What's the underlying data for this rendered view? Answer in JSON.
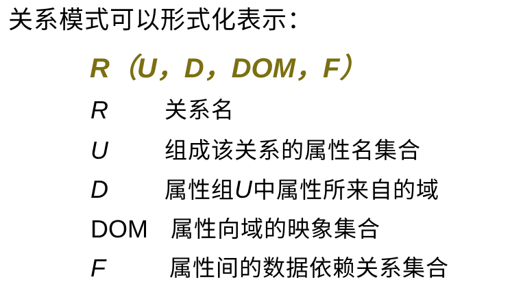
{
  "heading": "关系模式可以形式化表示：",
  "formula": "R（U，D，DOM，F）",
  "terms": [
    {
      "symbol": "R",
      "description": "关系名"
    },
    {
      "symbol": "U",
      "description": "组成该关系的属性名集合"
    },
    {
      "symbol": "D",
      "description_before": "属性组",
      "description_em": "U",
      "description_after": "中属性所来自的域"
    },
    {
      "symbol": "DOM",
      "description": "属性向域的映象集合"
    },
    {
      "symbol": "F",
      "description": "属性间的数据依赖关系集合"
    }
  ],
  "colors": {
    "formula": "#7b6f12",
    "text": "#000000",
    "background": "#ffffff"
  }
}
